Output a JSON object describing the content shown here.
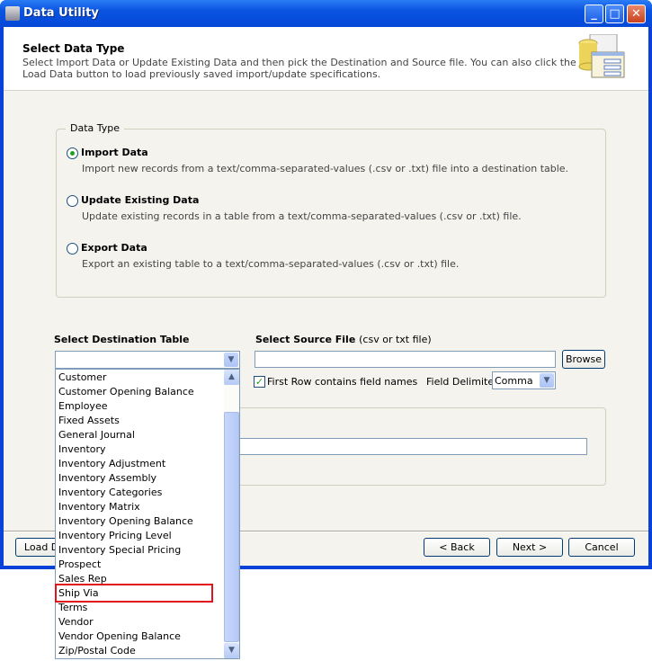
{
  "window": {
    "title": "Data Utility",
    "controls": [
      "minimize",
      "maximize",
      "close"
    ]
  },
  "header": {
    "title": "Select Data Type",
    "description": "Select Import Data or Update Existing Data and then pick the Destination and Source file.  You can also click the Load Data button to load previously saved import/update specifications."
  },
  "data_type": {
    "legend": "Data Type",
    "options": [
      {
        "label": "Import Data",
        "description": "Import new records from a text/comma-separated-values (.csv or .txt) file into a destination table.",
        "selected": true
      },
      {
        "label": "Update Existing Data",
        "description": "Update existing records in a table from a text/comma-separated-values (.csv or .txt) file.",
        "selected": false
      },
      {
        "label": "Export Data",
        "description": "Export an existing table to a text/comma-separated-values (.csv or .txt) file.",
        "selected": false
      }
    ]
  },
  "destination": {
    "label": "Select Destination Table",
    "value": "",
    "items": [
      "Customer",
      "Customer Opening Balance",
      "Employee",
      "Fixed Assets",
      "General Journal",
      "Inventory",
      "Inventory Adjustment",
      "Inventory Assembly",
      "Inventory Categories",
      "Inventory Matrix",
      "Inventory Opening Balance",
      "Inventory Pricing Level",
      "Inventory Special Pricing",
      "Prospect",
      "Sales Rep",
      "Ship Via",
      "Terms",
      "Vendor",
      "Vendor Opening Balance",
      "Zip/Postal Code"
    ],
    "highlighted": "Ship Via",
    "highlight_color": "#e0141b"
  },
  "source": {
    "label": "Select Source File",
    "hint": "(csv or txt file)",
    "value": "",
    "browse": "Browse",
    "first_row_label": "First Row contains field names",
    "first_row_checked": true,
    "delimiter_label": "Field Delimiter",
    "delimiter_value": "Comma"
  },
  "footer": {
    "load": "Load Data",
    "back": "< Back",
    "next": "Next >",
    "cancel": "Cancel"
  }
}
